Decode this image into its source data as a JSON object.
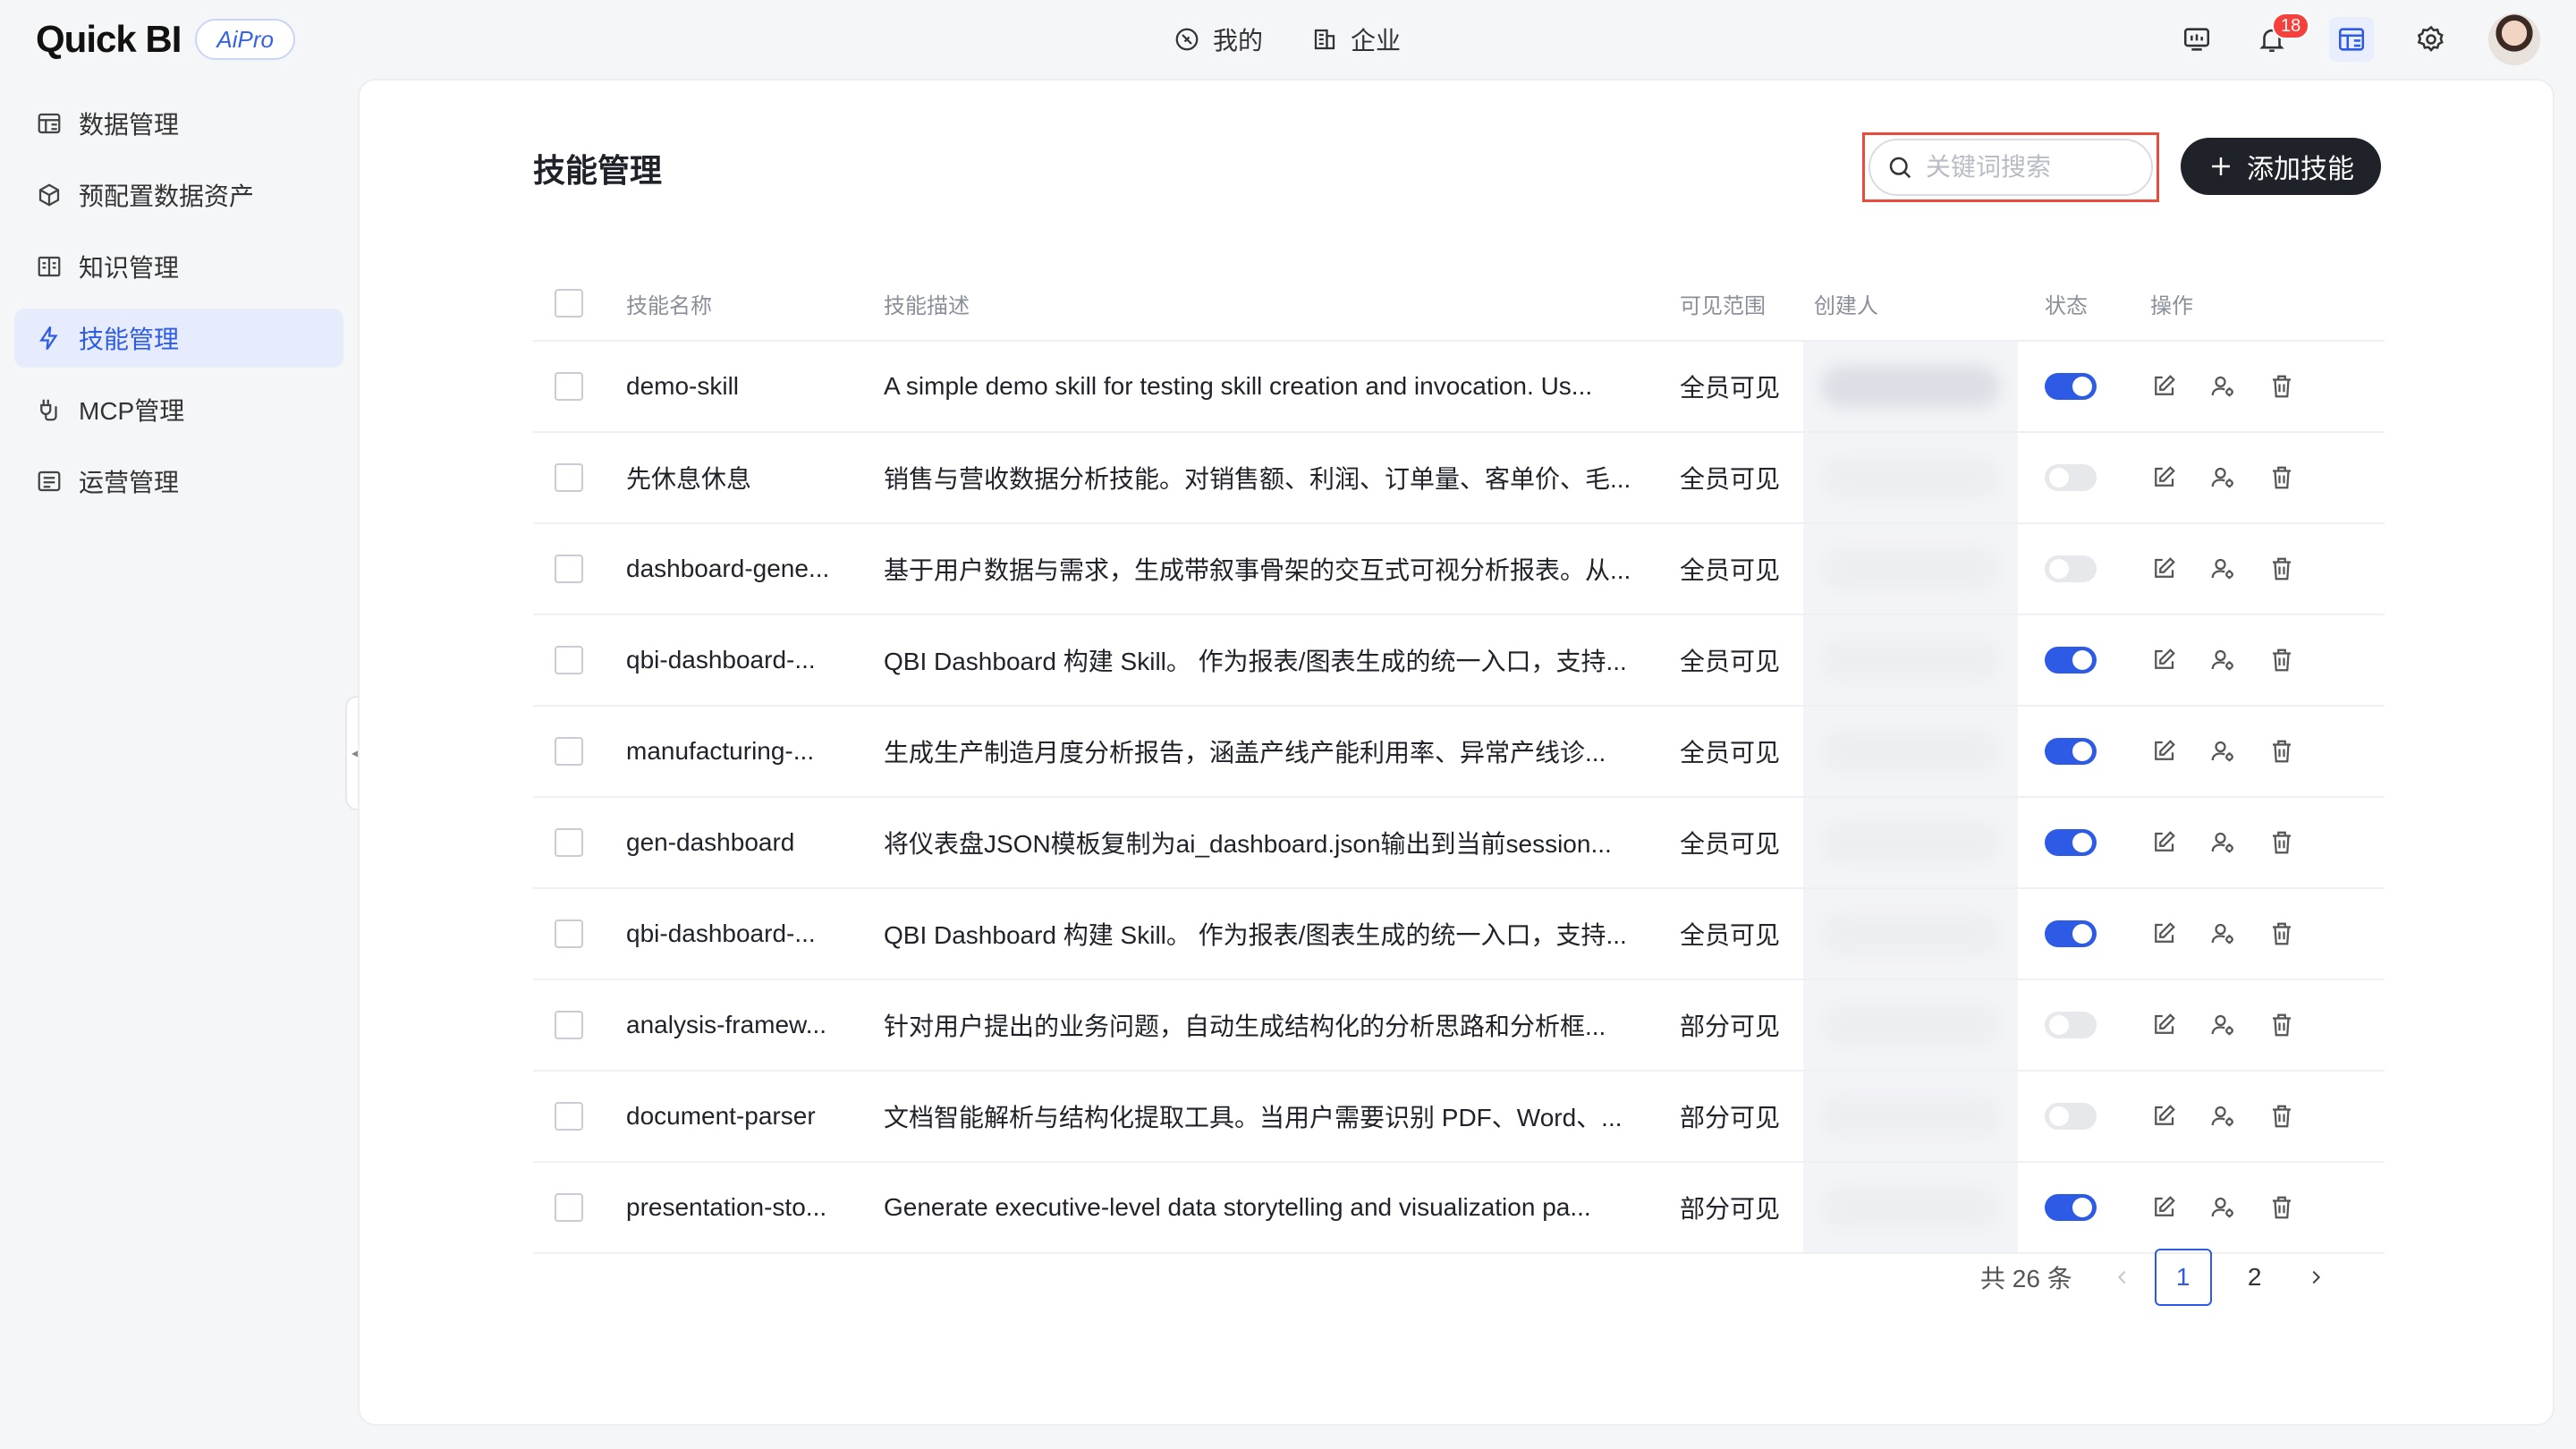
{
  "app": {
    "logo": "Quick BI",
    "badge": "AiPro"
  },
  "topnav": [
    {
      "label": "我的",
      "icon": "compass-icon"
    },
    {
      "label": "企业",
      "icon": "building-icon"
    }
  ],
  "header_right": {
    "notifications_count": "18"
  },
  "sidebar": {
    "items": [
      {
        "label": "数据管理",
        "icon": "data-table-icon"
      },
      {
        "label": "预配置数据资产",
        "icon": "cube-icon"
      },
      {
        "label": "知识管理",
        "icon": "book-icon"
      },
      {
        "label": "技能管理",
        "icon": "lightning-icon",
        "active": true
      },
      {
        "label": "MCP管理",
        "icon": "plug-icon"
      },
      {
        "label": "运营管理",
        "icon": "list-board-icon"
      }
    ]
  },
  "main": {
    "title": "技能管理",
    "search_placeholder": "关键词搜索",
    "add_label": "添加技能",
    "columns": {
      "name": "技能名称",
      "desc": "技能描述",
      "scope": "可见范围",
      "creator": "创建人",
      "status": "状态",
      "ops": "操作"
    },
    "rows": [
      {
        "name": "demo-skill",
        "desc": "A simple demo skill for testing skill creation and invocation. Us...",
        "scope": "全员可见",
        "enabled": true
      },
      {
        "name": "先休息休息",
        "desc": "销售与营收数据分析技能。对销售额、利润、订单量、客单价、毛...",
        "scope": "全员可见",
        "enabled": false
      },
      {
        "name": "dashboard-gene...",
        "desc": "基于用户数据与需求，生成带叙事骨架的交互式可视分析报表。从...",
        "scope": "全员可见",
        "enabled": false
      },
      {
        "name": "qbi-dashboard-...",
        "desc": "QBI Dashboard 构建 Skill。 作为报表/图表生成的统一入口，支持...",
        "scope": "全员可见",
        "enabled": true
      },
      {
        "name": "manufacturing-...",
        "desc": "生成生产制造月度分析报告，涵盖产线产能利用率、异常产线诊...",
        "scope": "全员可见",
        "enabled": true
      },
      {
        "name": "gen-dashboard",
        "desc": "将仪表盘JSON模板复制为ai_dashboard.json输出到当前session...",
        "scope": "全员可见",
        "enabled": true
      },
      {
        "name": "qbi-dashboard-...",
        "desc": "QBI Dashboard 构建 Skill。 作为报表/图表生成的统一入口，支持...",
        "scope": "全员可见",
        "enabled": true
      },
      {
        "name": "analysis-framew...",
        "desc": "针对用户提出的业务问题，自动生成结构化的分析思路和分析框...",
        "scope": "部分可见",
        "enabled": false
      },
      {
        "name": "document-parser",
        "desc": "文档智能解析与结构化提取工具。当用户需要识别 PDF、Word、...",
        "scope": "部分可见",
        "enabled": false
      },
      {
        "name": "presentation-sto...",
        "desc": "Generate executive-level data storytelling and visualization pa...",
        "scope": "部分可见",
        "enabled": true
      }
    ]
  },
  "pagination": {
    "total": "共 26 条",
    "pages": [
      "1",
      "2"
    ],
    "current": "1"
  },
  "colors": {
    "accent": "#2e5be6",
    "primary_button": "#1f2228",
    "highlight_border": "#e74c3c",
    "notification": "#f5403b"
  }
}
